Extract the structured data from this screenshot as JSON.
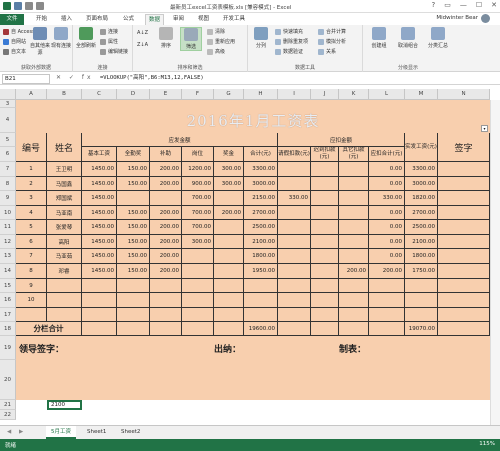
{
  "window": {
    "title": "最新员工excel工资表模板.xls [兼容模式] - Excel",
    "user": "Midwinter Bear",
    "controls": [
      "?",
      "▭",
      "—",
      "☐",
      "✕"
    ]
  },
  "tabs": [
    "文件",
    "开始",
    "插入",
    "页面布局",
    "公式",
    "数据",
    "审阅",
    "视图",
    "开发工具"
  ],
  "active_tab": "数据",
  "ribbon": {
    "external": {
      "access": "自 Access",
      "web": "自网站",
      "text": "自文本",
      "other": "自其他来源",
      "existing": "现有连接",
      "label": "获取外部数据"
    },
    "connections": {
      "refresh": "全部刷新",
      "conn": "连接",
      "props": "属性",
      "links": "编辑链接",
      "label": "连接"
    },
    "sort": {
      "asc": "A↓Z",
      "desc": "Z↓A",
      "sort": "排序",
      "filter": "筛选",
      "clear": "清除",
      "reapply": "重新应用",
      "advanced": "高级",
      "label": "排序和筛选"
    },
    "tools": {
      "split": "分列",
      "flash": "快速填充",
      "dup": "删除重复项",
      "valid": "数据验证",
      "merge": "合并计算",
      "whatif": "模拟分析",
      "rel": "关系",
      "label": "数据工具"
    },
    "outline": {
      "group": "创建组",
      "ungroup": "取消组合",
      "subtotal": "分类汇总",
      "label": "分级显示"
    }
  },
  "formula_bar": {
    "name_box": "B21",
    "fx": "✕ ✓ fx",
    "formula": "=VLOOKUP(\"高阳\",B6:M13,12,FALSE)"
  },
  "columns": [
    "A",
    "B",
    "C",
    "D",
    "E",
    "F",
    "G",
    "H",
    "I",
    "J",
    "K",
    "L",
    "M",
    "N"
  ],
  "rows": [
    "3",
    "4",
    "5",
    "6",
    "7",
    "8",
    "9",
    "10",
    "11",
    "12",
    "13",
    "14",
    "15",
    "16",
    "17",
    "18",
    "19",
    "20",
    "21",
    "22"
  ],
  "sheet": {
    "title": "2016年1月工资表",
    "headers": {
      "no": "编号",
      "name": "姓名",
      "pay_group": "应发金额",
      "base": "基本工资",
      "allowance": "全勤奖",
      "subsidy": "补助",
      "post": "岗位",
      "bonus": "奖金",
      "total": "合计(元)",
      "deduct_group": "应扣金额",
      "leave": "请假扣款(元)",
      "late": "迟到扣款(元)",
      "other": "其它扣款(元)",
      "deduct_total": "应扣合计(元)",
      "actual": "实发工资(元)",
      "sign": "签字"
    },
    "employees": [
      {
        "no": "1",
        "name": "王卫明",
        "base": "1450.00",
        "allowance": "150.00",
        "subsidy": "200.00",
        "post": "1200.00",
        "bonus": "300.00",
        "total": "3300.00",
        "leave": "",
        "late": "",
        "other": "",
        "deduct_total": "0.00",
        "actual": "3300.00"
      },
      {
        "no": "2",
        "name": "马国鑫",
        "base": "1450.00",
        "allowance": "150.00",
        "subsidy": "200.00",
        "post": "900.00",
        "bonus": "300.00",
        "total": "3000.00",
        "leave": "",
        "late": "",
        "other": "",
        "deduct_total": "0.00",
        "actual": "3000.00"
      },
      {
        "no": "3",
        "name": "郑国斌",
        "base": "1450.00",
        "allowance": "",
        "subsidy": "",
        "post": "700.00",
        "bonus": "",
        "total": "2150.00",
        "leave": "330.00",
        "late": "",
        "other": "",
        "deduct_total": "330.00",
        "actual": "1820.00"
      },
      {
        "no": "4",
        "name": "马亚南",
        "base": "1450.00",
        "allowance": "150.00",
        "subsidy": "200.00",
        "post": "700.00",
        "bonus": "200.00",
        "total": "2700.00",
        "leave": "",
        "late": "",
        "other": "",
        "deduct_total": "0.00",
        "actual": "2700.00"
      },
      {
        "no": "5",
        "name": "张爱琴",
        "base": "1450.00",
        "allowance": "150.00",
        "subsidy": "200.00",
        "post": "700.00",
        "bonus": "",
        "total": "2500.00",
        "leave": "",
        "late": "",
        "other": "",
        "deduct_total": "0.00",
        "actual": "2500.00"
      },
      {
        "no": "6",
        "name": "高阳",
        "base": "1450.00",
        "allowance": "150.00",
        "subsidy": "200.00",
        "post": "300.00",
        "bonus": "",
        "total": "2100.00",
        "leave": "",
        "late": "",
        "other": "",
        "deduct_total": "0.00",
        "actual": "2100.00"
      },
      {
        "no": "7",
        "name": "马亚茹",
        "base": "1450.00",
        "allowance": "150.00",
        "subsidy": "200.00",
        "post": "",
        "bonus": "",
        "total": "1800.00",
        "leave": "",
        "late": "",
        "other": "",
        "deduct_total": "0.00",
        "actual": "1800.00"
      },
      {
        "no": "8",
        "name": "邓睿",
        "base": "1450.00",
        "allowance": "150.00",
        "subsidy": "200.00",
        "post": "",
        "bonus": "",
        "total": "1950.00",
        "leave": "",
        "late": "",
        "other": "200.00",
        "deduct_total": "200.00",
        "actual": "1750.00"
      }
    ],
    "empty_rows": [
      "9",
      "10"
    ],
    "totals": {
      "label": "分栏合计",
      "total": "19600.00",
      "actual": "19070.00"
    },
    "footer": {
      "leader": "领导签字：",
      "cashier": "出纳：",
      "maker": "制表："
    },
    "b21_value": "2100"
  },
  "sheet_tabs": [
    "5月工资",
    "Sheet1",
    "Sheet2"
  ],
  "active_sheet": "5月工资",
  "status": {
    "ready": "就绪",
    "zoom": "115%"
  }
}
